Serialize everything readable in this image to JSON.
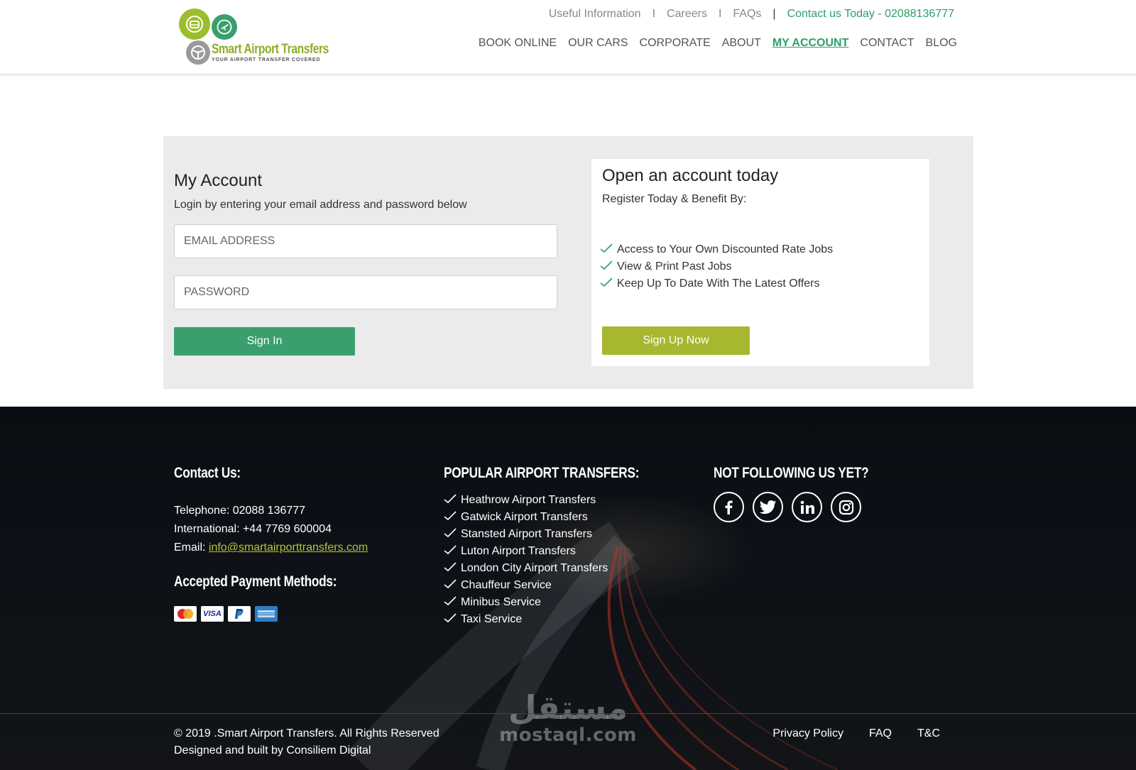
{
  "brand": {
    "name": "Smart Airport Transfers",
    "tagline": "YOUR AIRPORT TRANSFER COVERED",
    "green": "#3a9f6d",
    "lime": "#a7b72f"
  },
  "topbar": {
    "useful_info": "Useful Information",
    "careers": "Careers",
    "faqs": "FAQs",
    "separator": "I",
    "separator_bar": "|",
    "contact": "Contact us Today - 02088136777"
  },
  "nav": {
    "book_online": "BOOK ONLINE",
    "our_cars": "OUR CARS",
    "corporate": "CORPORATE",
    "about": "ABOUT",
    "my_account": "MY ACCOUNT",
    "contact": "CONTACT",
    "blog": "BLOG",
    "active": "MY ACCOUNT"
  },
  "login": {
    "title": "My Account",
    "subtitle": "Login by entering your email address and password below",
    "email_placeholder": "EMAIL ADDRESS",
    "password_placeholder": "PASSWORD",
    "signin_label": "Sign In"
  },
  "register": {
    "title": "Open an account today",
    "subtitle": "Register Today & Benefit By:",
    "benefits": [
      "Access to Your Own Discounted Rate Jobs",
      "View & Print Past Jobs",
      "Keep Up To Date With The Latest Offers"
    ],
    "signup_label": "Sign Up Now"
  },
  "footer": {
    "contact_title": "Contact Us:",
    "telephone": "Telephone: 02088 136777",
    "international": "International: +44 7769 600004",
    "email_label": "Email:",
    "email": "info@smartairporttransfers.com",
    "payment_title": "Accepted Payment Methods:",
    "payment_methods": [
      "mastercard-icon",
      "visa-icon",
      "paypal-icon",
      "amex-icon"
    ],
    "visa_text": "VISA",
    "popular_title": "POPULAR AIRPORT TRANSFERS:",
    "popular": [
      "Heathrow Airport Transfers",
      "Gatwick Airport Transfers",
      "Stansted Airport Transfers",
      "Luton Airport Transfers",
      "London City Airport Transfers",
      "Chauffeur Service",
      "Minibus Service",
      "Taxi Service"
    ],
    "social_title": "NOT FOLLOWING US YET?",
    "social_icons": [
      "facebook-icon",
      "twitter-icon",
      "linkedin-icon",
      "instagram-icon"
    ],
    "copyright": "© 2019 .Smart Airport Transfers. All Rights Reserved",
    "designed_by": "Designed and built by Consiliem Digital",
    "links": {
      "privacy": "Privacy Policy",
      "faq": "FAQ",
      "tc": "T&C"
    }
  },
  "watermark": {
    "arabic": "مستقل",
    "latin": "mostaql.com"
  }
}
